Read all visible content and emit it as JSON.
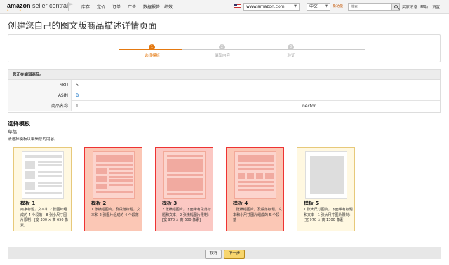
{
  "header": {
    "logo_bold": "amazon",
    "logo_text": "seller central",
    "nav": [
      "库存",
      "定价",
      "订单",
      "广告",
      "数据报告",
      "绩效"
    ],
    "marketplace": "www.amazon.com",
    "language": "中文",
    "language_note": "新功能",
    "search_placeholder": "搜索",
    "links": [
      "买家消息",
      "帮助",
      "设置"
    ]
  },
  "page_title": "创建您自己的图文版商品描述详情页面",
  "stepper": {
    "steps": [
      {
        "num": "1",
        "label": "选择模板",
        "active": true
      },
      {
        "num": "2",
        "label": "编辑内容",
        "active": false
      },
      {
        "num": "3",
        "label": "验证",
        "active": false
      }
    ]
  },
  "info": {
    "heading": "您正在编辑商品。",
    "rows": [
      {
        "key": "SKU",
        "value": "5",
        "extra": ""
      },
      {
        "key": "ASIN",
        "value": "B",
        "extra": ""
      },
      {
        "key": "商品名称",
        "value": "1",
        "extra": "nector"
      }
    ]
  },
  "section": {
    "title": "选择模板",
    "subtitle": "草稿",
    "hint": "请选择模板以编辑您的内容。"
  },
  "templates": [
    {
      "name": "模板 1",
      "desc": "商家标题，文本和 2 张图片组成的 4 个段落，8 张小尺寸图片限制：[宽 300 × 高 650 像素]",
      "selected": false
    },
    {
      "name": "模板 2",
      "desc": "1 张横幅图片，及段落标题，文本和 2 张图片组成的 4 个段落",
      "selected": true
    },
    {
      "name": "模板 3",
      "desc": "2 张横幅图片，下面带有段落标题和文本，2 张横幅图片限制：[宽 970 × 高 600 像素]",
      "selected": true
    },
    {
      "name": "模板 4",
      "desc": "1 张横幅图片，及段落标题，文本和小尺寸图片组成的 5 个段落",
      "selected": true
    },
    {
      "name": "模板 5",
      "desc": "1 张大尺寸图片，下面带有标题和文本 · 1 张大尺寸图片限制：[宽 970 × 高 1300 像素]",
      "selected": false
    }
  ],
  "footer": {
    "cancel": "取消",
    "next": "下一步"
  },
  "colors": {
    "accent": "#e47911",
    "selected_border": "#e33333",
    "link": "#0066c0"
  }
}
